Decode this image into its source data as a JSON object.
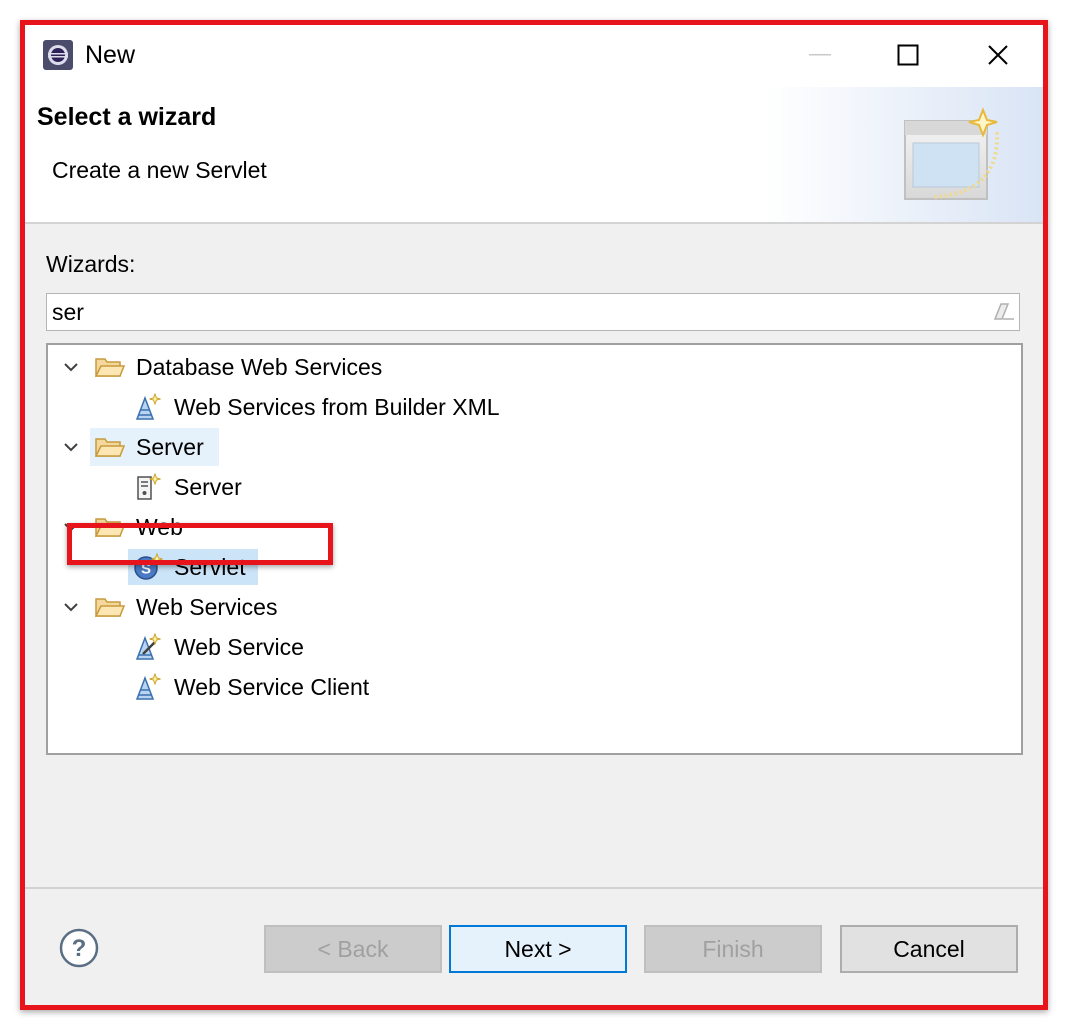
{
  "window": {
    "title": "New"
  },
  "header": {
    "title": "Select a wizard",
    "description": "Create a new Servlet"
  },
  "wizards": {
    "label": "Wizards:",
    "filter_value": "ser",
    "tree": [
      {
        "label": "Database Web Services",
        "expanded": true,
        "children": [
          {
            "label": "Web Services from Builder XML",
            "icon": "web-service-icon"
          }
        ]
      },
      {
        "label": "Server",
        "expanded": true,
        "children": [
          {
            "label": "Server",
            "icon": "server-icon"
          }
        ]
      },
      {
        "label": "Web",
        "expanded": true,
        "children": [
          {
            "label": "Servlet",
            "icon": "servlet-icon",
            "selected": true
          }
        ]
      },
      {
        "label": "Web Services",
        "expanded": true,
        "children": [
          {
            "label": "Web Service",
            "icon": "web-service-icon"
          },
          {
            "label": "Web Service Client",
            "icon": "web-service-client-icon"
          }
        ]
      }
    ]
  },
  "buttons": {
    "back": "< Back",
    "next": "Next >",
    "finish": "Finish",
    "cancel": "Cancel"
  },
  "colors": {
    "highlight_border": "#e8141c",
    "selection": "#cce4f7",
    "default_button_border": "#0078d7"
  }
}
